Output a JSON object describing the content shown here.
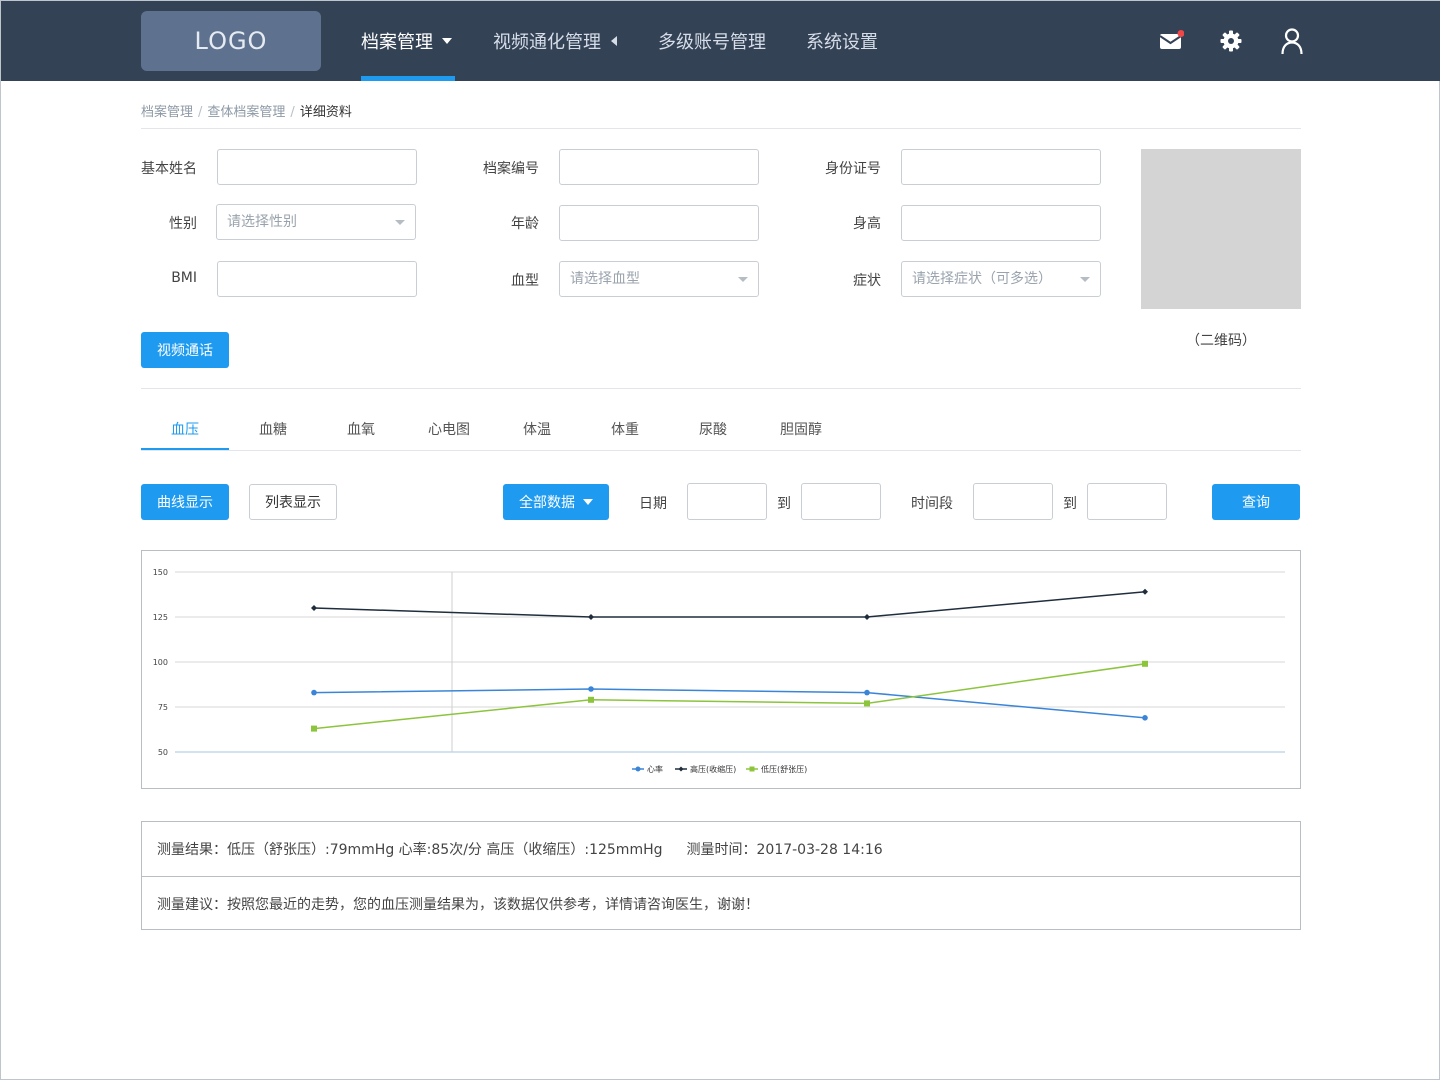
{
  "header": {
    "logo": "LOGO",
    "nav": [
      {
        "label": "档案管理",
        "active": true
      },
      {
        "label": "视频通化管理"
      },
      {
        "label": "多级账号管理"
      },
      {
        "label": "系统设置"
      }
    ],
    "icons": [
      "mail-icon",
      "gear-icon",
      "user-icon"
    ],
    "colors": {
      "bar": "#344256",
      "accent": "#1e9bf0",
      "notify": "#f04848"
    }
  },
  "breadcrumb": [
    "档案管理",
    "查体档案管理",
    "详细资料"
  ],
  "form": {
    "name_label": "基本姓名",
    "file_no_label": "档案编号",
    "id_label": "身份证号",
    "gender_label": "性别",
    "gender_placeholder": "请选择性别",
    "age_label": "年龄",
    "height_label": "身高",
    "bmi_label": "BMI",
    "blood_label": "血型",
    "blood_placeholder": "请选择血型",
    "symptom_label": "症状",
    "symptom_placeholder": "请选择症状（可多选）"
  },
  "qr_label": "（二维码）",
  "video_button": "视频通话",
  "tabs": [
    "血压",
    "血糖",
    "血氧",
    "心电图",
    "体温",
    "体重",
    "尿酸",
    "胆固醇"
  ],
  "toolbar": {
    "curve": "曲线显示",
    "list": "列表显示",
    "all_data": "全部数据",
    "date": "日期",
    "to1": "到",
    "period": "时间段",
    "to2": "到",
    "query": "查询"
  },
  "chart_data": {
    "type": "line",
    "x": [
      1,
      2,
      3,
      4
    ],
    "ylim": [
      50,
      150
    ],
    "yticks": [
      50,
      75,
      100,
      125,
      150
    ],
    "grid": true,
    "legend": "bottom",
    "series": [
      {
        "name": "心率",
        "values": [
          83,
          85,
          83,
          69
        ],
        "color": "#3a85d8",
        "marker": "circle"
      },
      {
        "name": "高压(收缩压)",
        "values": [
          130,
          125,
          125,
          139
        ],
        "color": "#1f2d3d",
        "marker": "diamond"
      },
      {
        "name": "低压(舒张压)",
        "values": [
          63,
          79,
          77,
          99
        ],
        "color": "#8cc43c",
        "marker": "square"
      }
    ]
  },
  "result": {
    "measure": "测量结果：低压（舒张压）:79mmHg 心率:85次/分 高压（收缩压）:125mmHg",
    "time": "测量时间：2017-03-28 14:16",
    "advice": "测量建议：按照您最近的走势，您的血压测量结果为，该数据仅供参考，详情请咨询医生，谢谢！"
  }
}
